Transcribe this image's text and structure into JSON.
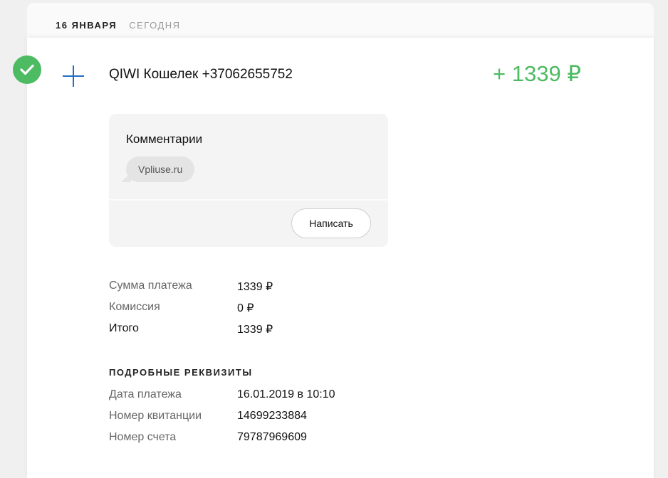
{
  "date": {
    "main": "16 ЯНВАРЯ",
    "sub": "СЕГОДНЯ"
  },
  "transaction": {
    "status_icon": "check-icon",
    "type_icon": "plus-icon",
    "provider": "QIWI Кошелек +37062655752",
    "amount": "+ 1339 ₽",
    "amount_color": "#4cbb62"
  },
  "comments": {
    "title": "Комментарии",
    "items": [
      "Vpliuse.ru"
    ],
    "write_button": "Написать"
  },
  "summary": {
    "rows": [
      {
        "label": "Сумма платежа",
        "value": "1339 ₽"
      },
      {
        "label": "Комиссия",
        "value": "0 ₽"
      },
      {
        "label": "Итого",
        "value": "1339 ₽"
      }
    ]
  },
  "details": {
    "title": "ПОДРОБНЫЕ РЕКВИЗИТЫ",
    "rows": [
      {
        "label": "Дата платежа",
        "value": "16.01.2019 в 10:10"
      },
      {
        "label": "Номер квитанции",
        "value": "14699233884"
      },
      {
        "label": "Номер счета",
        "value": "79787969609"
      }
    ]
  }
}
